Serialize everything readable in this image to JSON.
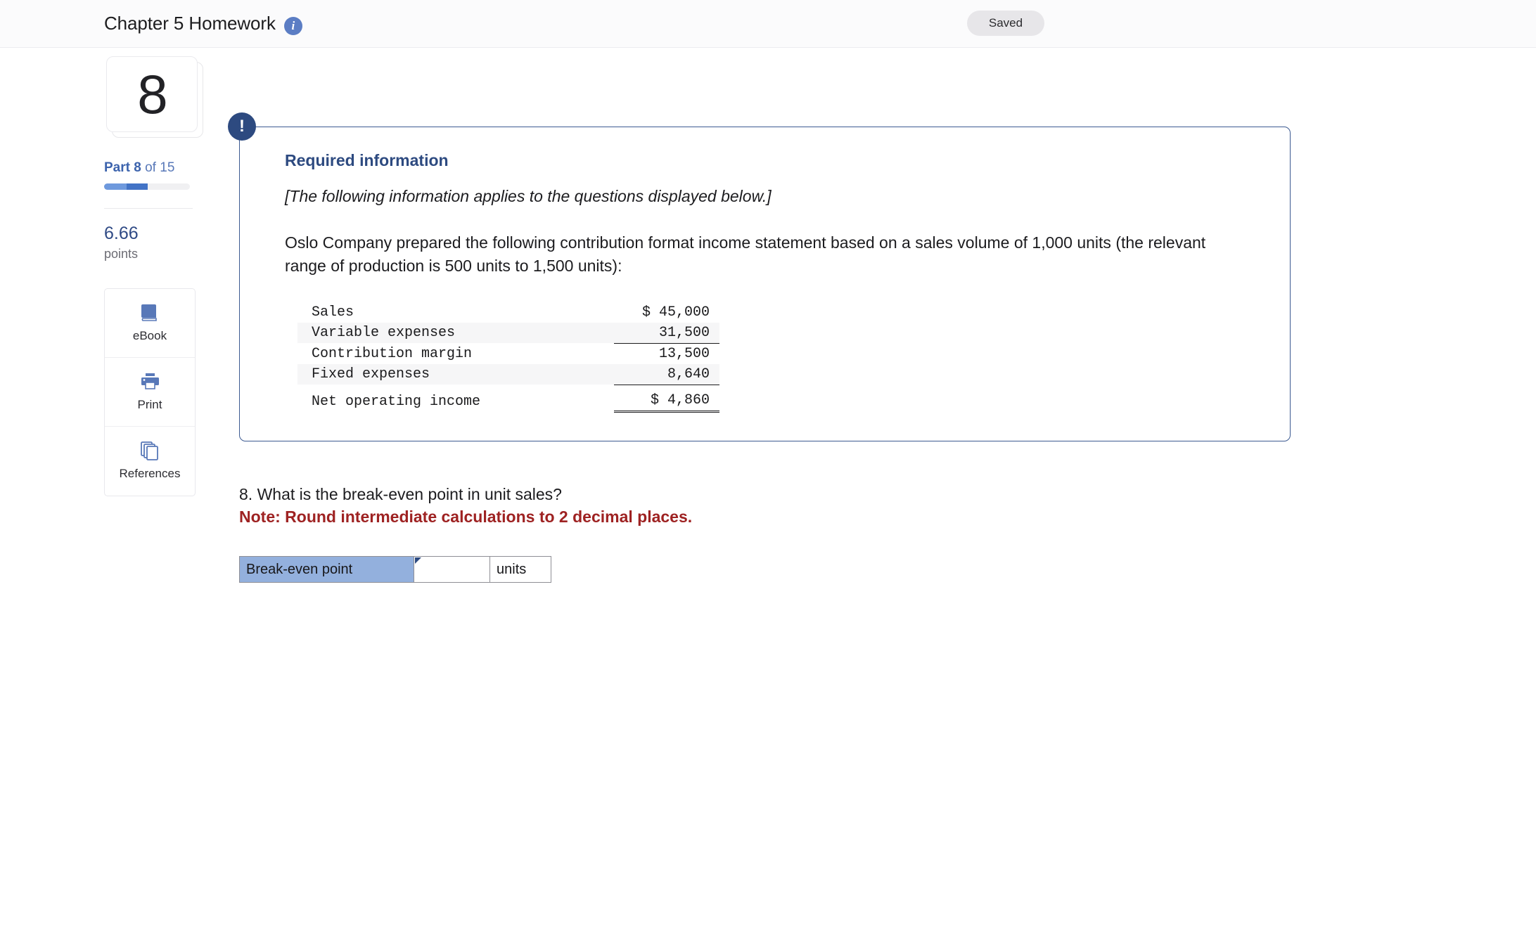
{
  "header": {
    "title": "Chapter 5 Homework",
    "info_icon": "info-icon",
    "saved_label": "Saved"
  },
  "rail": {
    "question_number": "8",
    "part_prefix": "Part",
    "part_current": "8",
    "part_of": "of",
    "part_total": "15",
    "points_value": "6.66",
    "points_label": "points",
    "tools": [
      {
        "icon": "ebook-icon",
        "label": "eBook"
      },
      {
        "icon": "print-icon",
        "label": "Print"
      },
      {
        "icon": "references-icon",
        "label": "References"
      }
    ]
  },
  "callout": {
    "badge": "!",
    "title": "Required information",
    "italic_note": "[The following information applies to the questions displayed below.]",
    "body": "Oslo Company prepared the following contribution format income statement based on a sales volume of 1,000 units (the relevant range of production is 500 units to 1,500 units):",
    "statement": {
      "rows": [
        {
          "label": "Sales",
          "amount": "$ 45,000",
          "shaded": false,
          "rule": "none"
        },
        {
          "label": "Variable expenses",
          "amount": "31,500",
          "shaded": true,
          "rule": "single"
        },
        {
          "label": "Contribution margin",
          "amount": "13,500",
          "shaded": false,
          "rule": "none"
        },
        {
          "label": "Fixed expenses",
          "amount": "8,640",
          "shaded": true,
          "rule": "single"
        },
        {
          "label": "Net operating income",
          "amount": "$ 4,860",
          "shaded": false,
          "rule": "double"
        }
      ]
    }
  },
  "question": {
    "text": "8. What is the break-even point in unit sales?",
    "note": "Note: Round intermediate calculations to 2 decimal places.",
    "answer_label": "Break-even point",
    "answer_value": "",
    "answer_placeholder": "",
    "answer_units": "units"
  }
}
